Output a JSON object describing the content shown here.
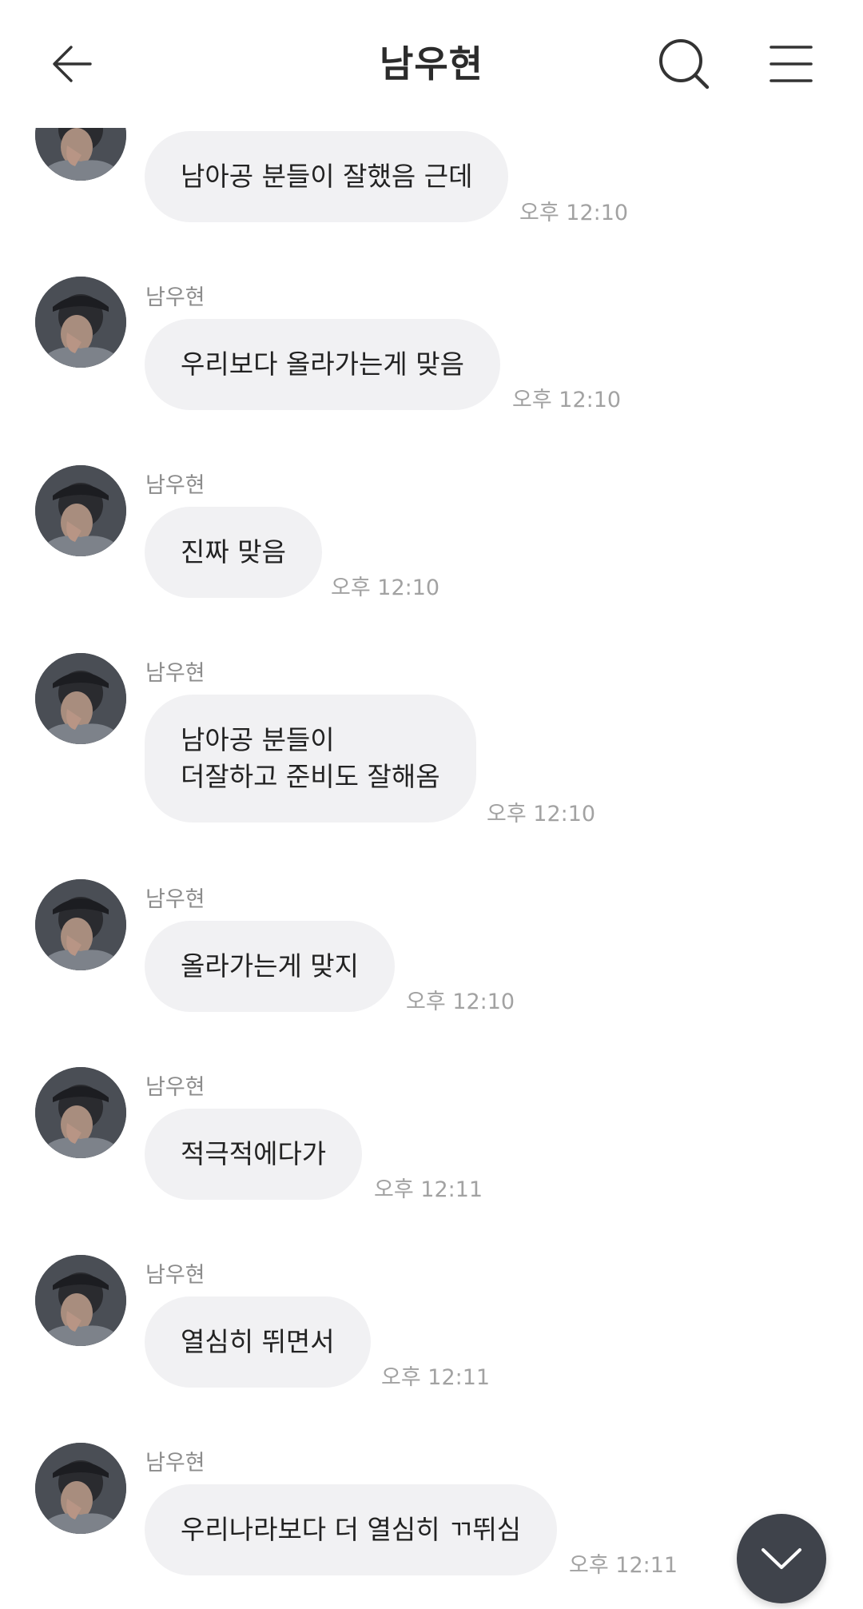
{
  "header": {
    "title": "남우현",
    "back_icon": "arrow-left-icon",
    "search_icon": "search-icon",
    "menu_icon": "menu-icon"
  },
  "messages": [
    {
      "sender": "",
      "text": "남아공 분들이 잘했음 근데",
      "time": "오후 12:10"
    },
    {
      "sender": "남우현",
      "text": "우리보다 올라가는게 맞음",
      "time": "오후 12:10"
    },
    {
      "sender": "남우현",
      "text": "진짜 맞음",
      "time": "오후 12:10"
    },
    {
      "sender": "남우현",
      "text": "남아공 분들이\n더잘하고 준비도 잘해옴",
      "time": "오후 12:10"
    },
    {
      "sender": "남우현",
      "text": "올라가는게 맞지",
      "time": "오후 12:10"
    },
    {
      "sender": "남우현",
      "text": "적극적에다가",
      "time": "오후 12:11"
    },
    {
      "sender": "남우현",
      "text": "열심히 뛰면서",
      "time": "오후 12:11"
    },
    {
      "sender": "남우현",
      "text": "우리나라보다 더 열심히 ㄲ뛰심",
      "time": "오후 12:11"
    }
  ],
  "scroll_down": {
    "icon": "chevron-down-icon"
  },
  "colors": {
    "bubble": "#f1f1f3",
    "fab": "#3f434b",
    "time": "#a2a2a2",
    "sender": "#8c8c8c"
  }
}
